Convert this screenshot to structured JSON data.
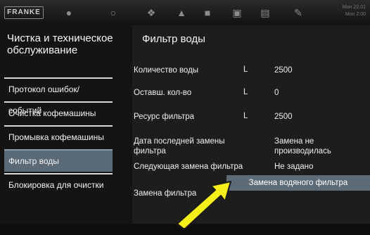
{
  "header": {
    "brand": "FRANKE",
    "icons": [
      "bean-icon",
      "cup-icon",
      "cleaning-icon",
      "drop-icon",
      "cups-icon",
      "cash-icon",
      "report-icon",
      "wrench-icon"
    ],
    "clock_lines": [
      "Mon 22.01",
      "Mon 2:00"
    ]
  },
  "sidebar": {
    "title": "Чистка и техническое обслуживание",
    "items": [
      {
        "label": "Протокол ошибок/событий"
      },
      {
        "label": "Очистка кофемашины"
      },
      {
        "label": "Промывка кофемашины"
      },
      {
        "label": "Фильтр воды",
        "active": true
      },
      {
        "label": "Блокировка для очистки"
      }
    ]
  },
  "page": {
    "title": "Фильтр воды",
    "rows": [
      {
        "label": "Количество воды",
        "unit": "L",
        "value": "2500"
      },
      {
        "label": "Оставш. кол-во",
        "unit": "L",
        "value": "0"
      },
      {
        "label": "Ресурс фильтра",
        "unit": "L",
        "value": "2500"
      },
      {
        "label": "Дата последней замены фильтра",
        "unit": "",
        "value": "Замена не производилась"
      },
      {
        "label": "Следующая замена фильтра",
        "unit": "",
        "value": "Не задано"
      }
    ],
    "replace_label": "Замена фильтра",
    "replace_button": "Замена водяного фильтра"
  },
  "colors": {
    "accent": "#5d6b76",
    "arrow": "#f4ef1a"
  }
}
